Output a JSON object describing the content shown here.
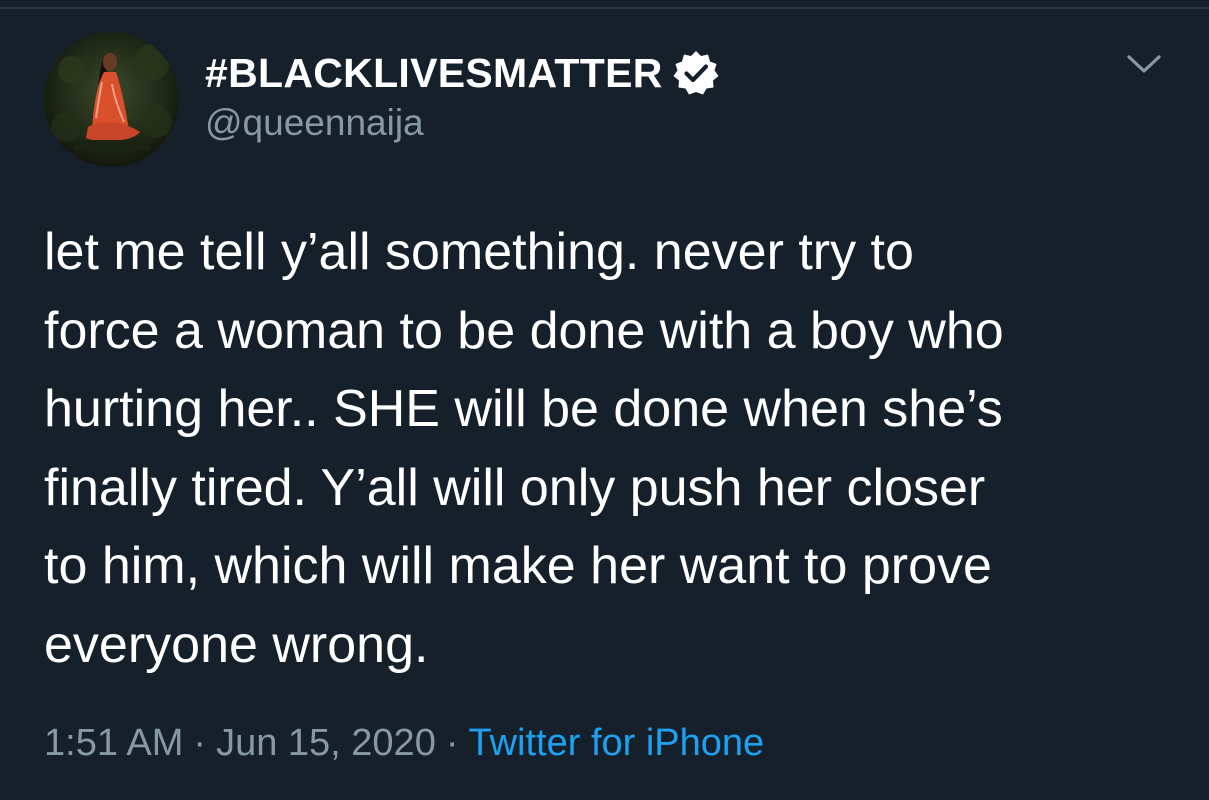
{
  "author": {
    "display_name": "#BLACKLIVESMATTER",
    "handle": "@queennaija",
    "verified": true
  },
  "tweet": {
    "lines": [
      "let me tell y’all something.  never try to",
      "force a woman to be done with a boy who",
      "hurting her.. SHE will be done when she’s",
      "finally tired. Y’all will only push her closer",
      "to him, which will make her want to prove",
      "everyone wrong."
    ]
  },
  "meta": {
    "time": "1:51 AM",
    "separator": "·",
    "date": "Jun 15, 2020",
    "source": "Twitter for iPhone"
  },
  "icons": {
    "verified": "verified-badge-icon",
    "menu": "chevron-down-icon"
  },
  "colors": {
    "background": "#15202b",
    "secondary_text": "#8899a6",
    "link": "#1da1f2"
  }
}
